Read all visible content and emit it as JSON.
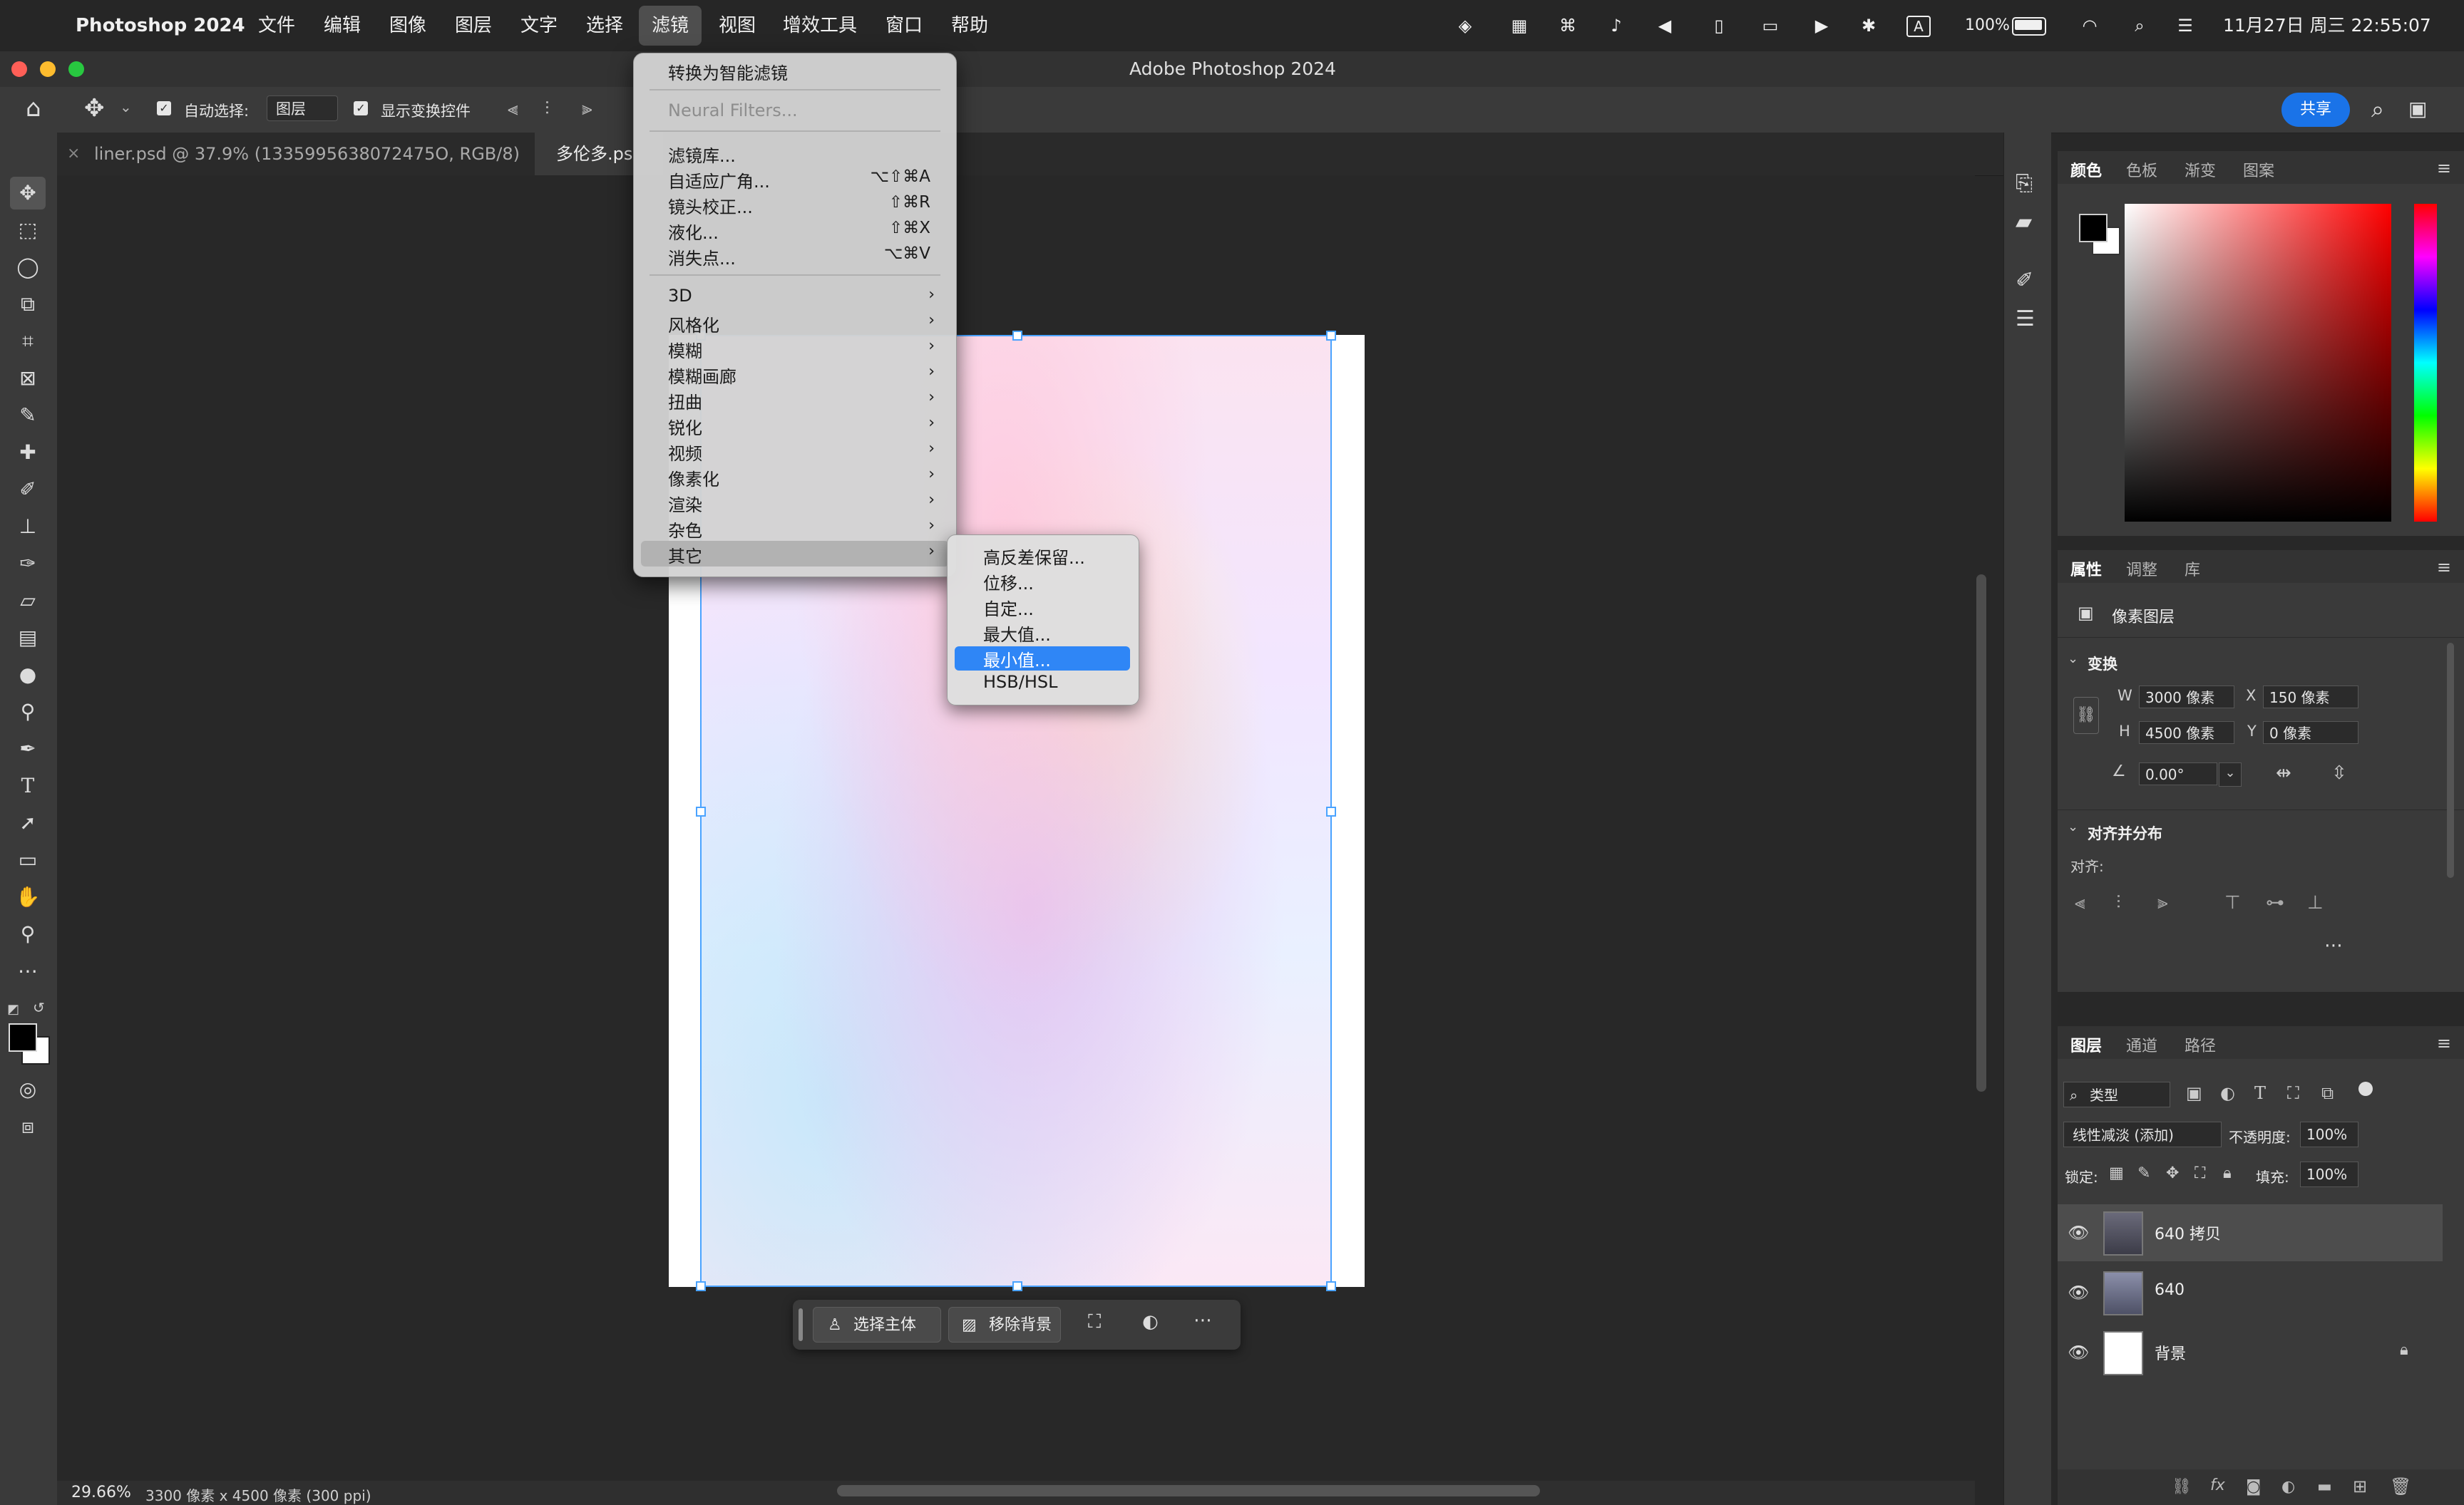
{
  "menubar": {
    "app_name": "Photoshop 2024",
    "items": [
      "文件",
      "编辑",
      "图像",
      "图层",
      "文字",
      "选择",
      "滤镜",
      "视图",
      "增效工具",
      "窗口",
      "帮助"
    ],
    "active_item": "滤镜",
    "battery": "100%",
    "datetime": "11月27日 周三 22:55:07",
    "input_indicator": "A"
  },
  "window": {
    "title": "Adobe Photoshop 2024"
  },
  "options_bar": {
    "auto_select_label": "自动选择:",
    "auto_select_target": "图层",
    "show_transform_label": "显示变换控件",
    "share_label": "共享"
  },
  "tabs": [
    {
      "label": "liner.psd @ 37.9% (1335995638072475O, RGB/8)"
    },
    {
      "label": "多伦多.ps"
    }
  ],
  "filter_menu": {
    "items": [
      {
        "label": "转换为智能滤镜",
        "shortcut": ""
      },
      {
        "label": "Neural Filters...",
        "shortcut": ""
      },
      {
        "label": "滤镜库...",
        "shortcut": ""
      },
      {
        "label": "自适应广角...",
        "shortcut": "⌥⇧⌘A"
      },
      {
        "label": "镜头校正...",
        "shortcut": "⇧⌘R"
      },
      {
        "label": "液化...",
        "shortcut": "⇧⌘X"
      },
      {
        "label": "消失点...",
        "shortcut": "⌥⌘V"
      },
      {
        "label": "3D"
      },
      {
        "label": "风格化"
      },
      {
        "label": "模糊"
      },
      {
        "label": "模糊画廊"
      },
      {
        "label": "扭曲"
      },
      {
        "label": "锐化"
      },
      {
        "label": "视频"
      },
      {
        "label": "像素化"
      },
      {
        "label": "渲染"
      },
      {
        "label": "杂色"
      },
      {
        "label": "其它"
      }
    ],
    "highlighted": "其它"
  },
  "other_submenu": {
    "items": [
      "高反差保留...",
      "位移...",
      "自定...",
      "最大值...",
      "最小值...",
      "HSB/HSL"
    ],
    "selected": "最小值..."
  },
  "taskbar": {
    "select_subject": "选择主体",
    "remove_background": "移除背景"
  },
  "statusbar": {
    "zoom": "29.66%",
    "doc_info": "3300 像素 x 4500 像素 (300 ppi)"
  },
  "color_panel": {
    "tabs": [
      "颜色",
      "色板",
      "渐变",
      "图案"
    ],
    "foreground": "#000000",
    "background": "#ffffff",
    "hue_color": "#ff0000"
  },
  "properties_panel": {
    "tabs": [
      "属性",
      "调整",
      "库"
    ],
    "type_label": "像素图层",
    "transform_title": "变换",
    "w_label": "W",
    "w_value": "3000 像素",
    "h_label": "H",
    "h_value": "4500 像素",
    "x_label": "X",
    "x_value": "150 像素",
    "y_label": "Y",
    "y_value": "0 像素",
    "angle_value": "0.00°",
    "align_title": "对齐并分布",
    "align_label": "对齐:"
  },
  "layers_panel": {
    "tabs": [
      "图层",
      "通道",
      "路径"
    ],
    "filter_label": "类型",
    "blend_mode": "线性减淡 (添加)",
    "opacity_label": "不透明度:",
    "opacity_value": "100%",
    "lock_label": "锁定:",
    "fill_label": "填充:",
    "fill_value": "100%",
    "layers": [
      {
        "name": "640 拷贝",
        "selected": true
      },
      {
        "name": "640",
        "selected": false
      },
      {
        "name": "背景",
        "selected": false
      }
    ]
  },
  "colors": {
    "accent": "#2f86f6",
    "selection": "#4aa3ff",
    "share": "#1a73e8"
  }
}
